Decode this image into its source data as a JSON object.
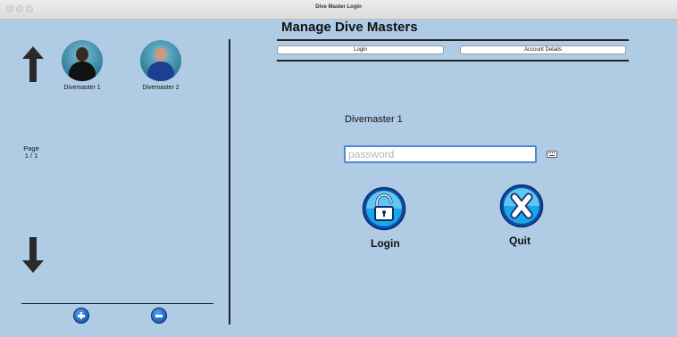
{
  "window": {
    "title": "Dive Master Login"
  },
  "left_panel": {
    "divemasters": [
      {
        "name": "Divemaster 1"
      },
      {
        "name": "Divemaster 2"
      }
    ],
    "page_label": "Page",
    "page_value": "1 / 1"
  },
  "main": {
    "heading": "Manage Dive Masters",
    "tabs": [
      {
        "label": "Login"
      },
      {
        "label": "Account Details"
      }
    ],
    "selected_user": "Divemaster 1",
    "password": {
      "value": "",
      "placeholder": "password"
    },
    "login_label": "Login",
    "quit_label": "Quit"
  },
  "colors": {
    "background": "#b0cbe4",
    "button_blue": "#1a5fbf",
    "focus_ring": "#4b8bd6"
  }
}
